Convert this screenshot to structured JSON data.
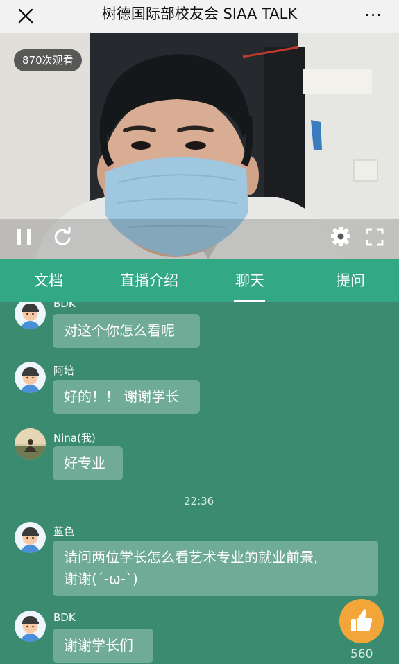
{
  "header": {
    "title": "树德国际部校友会 SIAA TALK",
    "more": "···"
  },
  "video": {
    "views": "870次观看"
  },
  "tabs": [
    {
      "label": "文档"
    },
    {
      "label": "直播介绍"
    },
    {
      "label": "聊天"
    },
    {
      "label": "提问"
    }
  ],
  "chat": [
    {
      "user": "BDK",
      "text": "对这个你怎么看呢"
    },
    {
      "user": "阿培",
      "text": "好的！！ 谢谢学长"
    },
    {
      "user": "Nina(我)",
      "text": "好专业"
    },
    {
      "user": "蓝色",
      "line1": "请问两位学长怎么看艺术专业的就业前景,",
      "line2": "谢谢(´-ω-`)"
    },
    {
      "user": "BDK",
      "text": "谢谢学长们"
    }
  ],
  "timestamp": "22:36",
  "like": {
    "count": "560",
    "icon": "thumbs-up-icon"
  },
  "colors": {
    "chat_bg": "#3a8b70",
    "tab_bar": "#33a884",
    "like": "#f2a63a"
  }
}
